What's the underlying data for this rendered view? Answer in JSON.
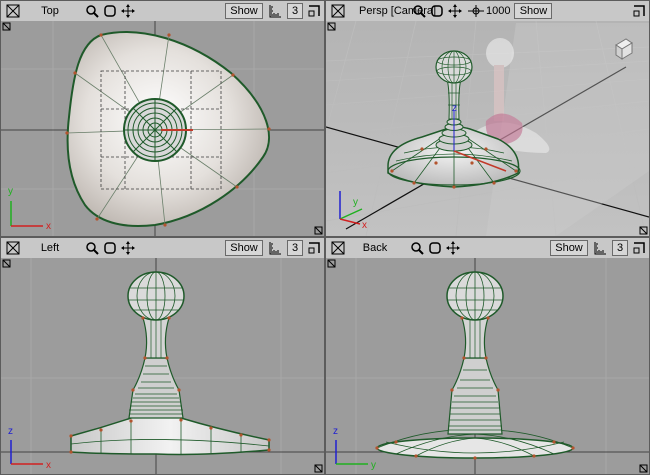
{
  "viewports": {
    "top": {
      "title": "Top",
      "show_label": "Show",
      "count": "3"
    },
    "persp": {
      "title": "Persp [Camera]",
      "show_label": "Show",
      "speed": "1000"
    },
    "left": {
      "title": "Left",
      "show_label": "Show",
      "count": "3"
    },
    "back": {
      "title": "Back",
      "show_label": "Show",
      "count": "3"
    }
  },
  "axes": {
    "top": {
      "h": "x",
      "v": "y"
    },
    "persp": {
      "h": "x",
      "v": "y",
      "z": "z"
    },
    "left": {
      "h": "x",
      "v": "z"
    },
    "back": {
      "h": "y",
      "v": "z"
    }
  },
  "colors": {
    "toolbar_bg": "#c8c8c8",
    "viewport_bg": "#9b9b9b",
    "wire_green": "#1f5a2a",
    "vertex_red": "#b3542e",
    "axis_x": "#d22020",
    "axis_y": "#20b020",
    "axis_z": "#2020d0"
  },
  "icons": [
    "maximize-icon",
    "zoom-icon",
    "fit-icon",
    "pan-icon",
    "grid-icon",
    "layout-icon",
    "fly-speed-icon"
  ]
}
